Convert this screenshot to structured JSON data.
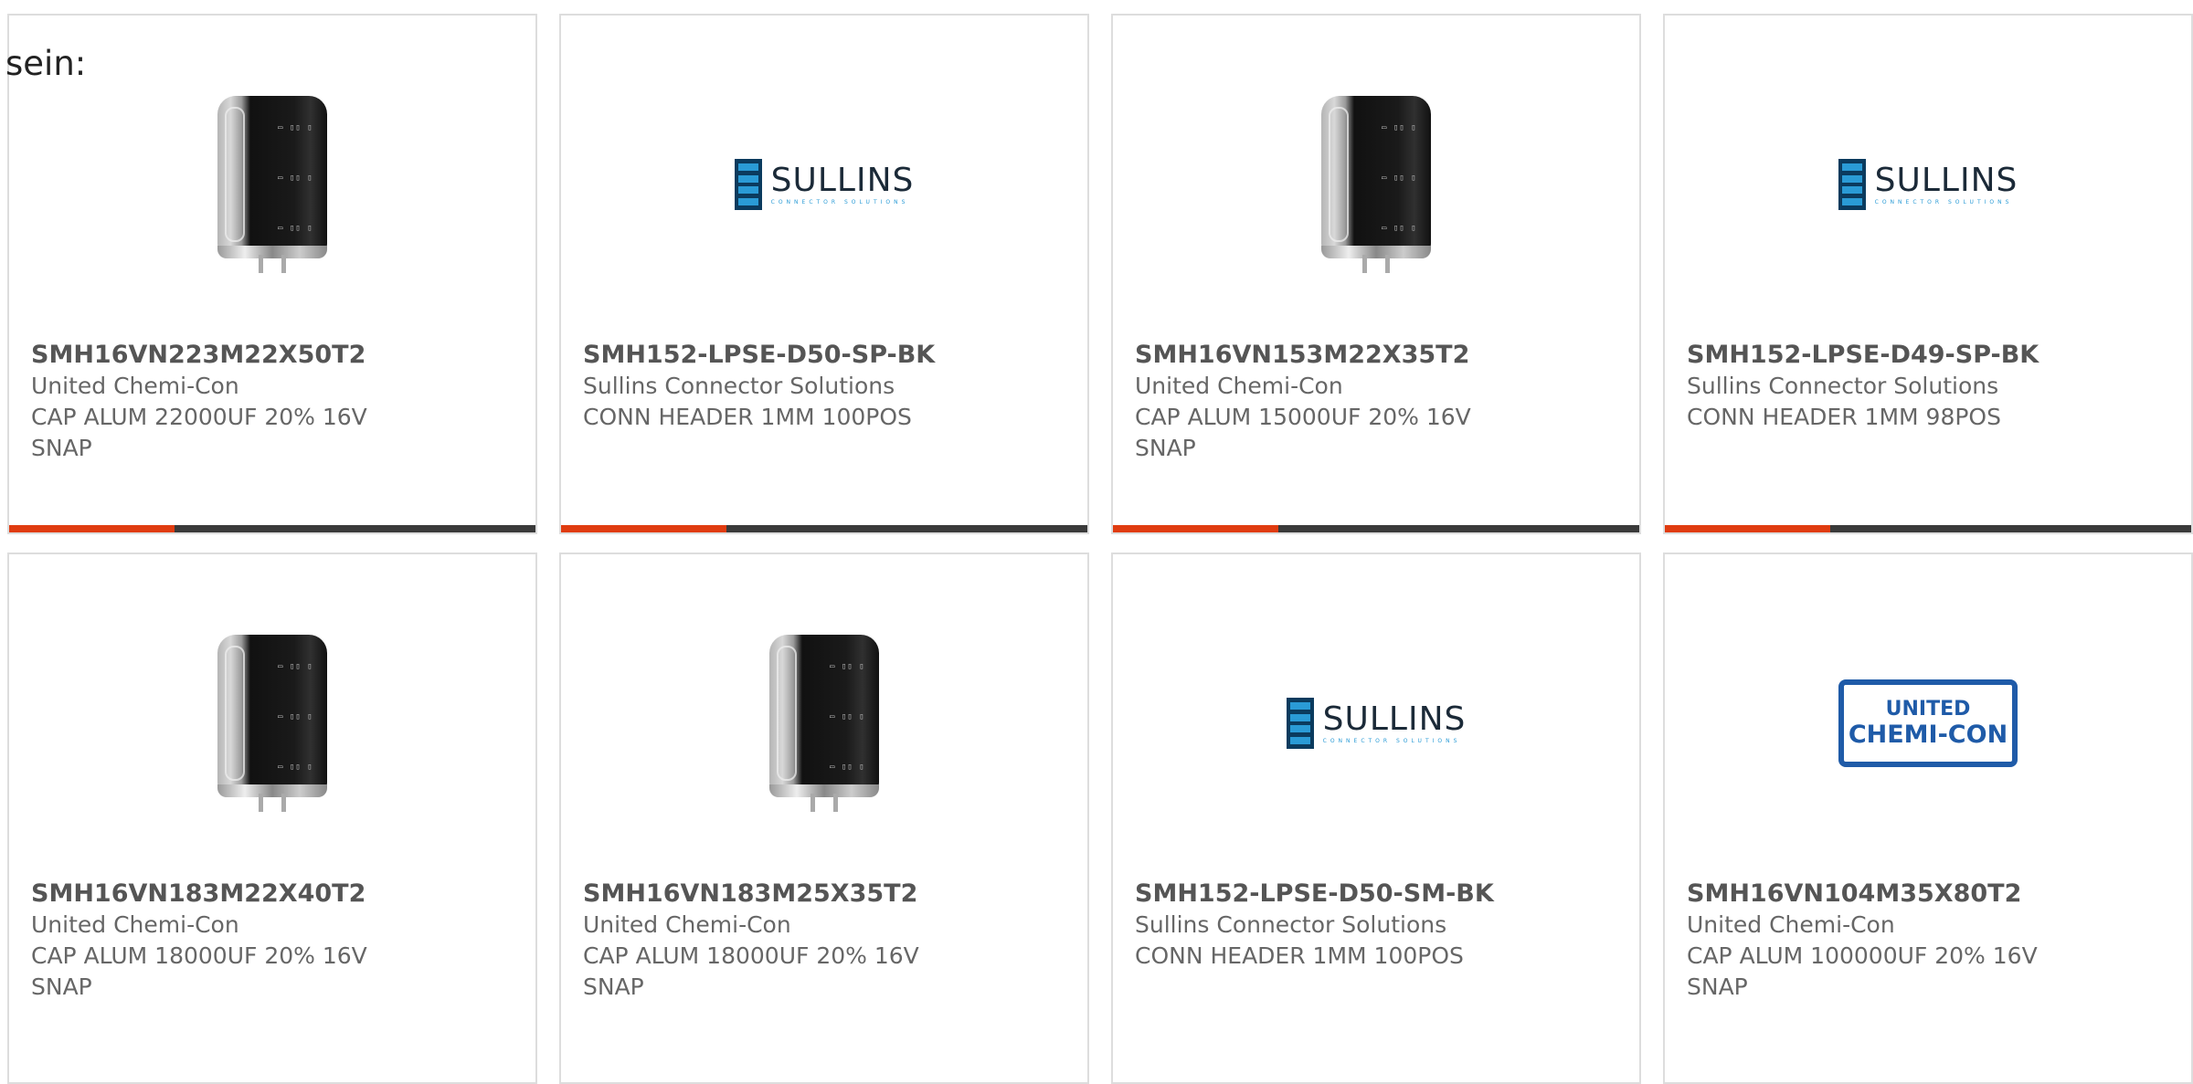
{
  "page_label": "sein:",
  "cards": [
    {
      "part_number": "SMH16VN223M22X50T2",
      "manufacturer": "United Chemi-Con",
      "description_line1": "CAP ALUM 22000UF 20% 16V",
      "description_line2": "SNAP",
      "image": "capacitor-photo"
    },
    {
      "part_number": "SMH152-LPSE-D50-SP-BK",
      "manufacturer": "Sullins Connector Solutions",
      "description_line1": "CONN HEADER 1MM 100POS",
      "description_line2": "",
      "image": "sullins-logo"
    },
    {
      "part_number": "SMH16VN153M22X35T2",
      "manufacturer": "United Chemi-Con",
      "description_line1": "CAP ALUM 15000UF 20% 16V",
      "description_line2": "SNAP",
      "image": "capacitor-photo"
    },
    {
      "part_number": "SMH152-LPSE-D49-SP-BK",
      "manufacturer": "Sullins Connector Solutions",
      "description_line1": "CONN HEADER 1MM 98POS",
      "description_line2": "",
      "image": "sullins-logo"
    },
    {
      "part_number": "SMH16VN183M22X40T2",
      "manufacturer": "United Chemi-Con",
      "description_line1": "CAP ALUM 18000UF 20% 16V",
      "description_line2": "SNAP",
      "image": "capacitor-photo"
    },
    {
      "part_number": "SMH16VN183M25X35T2",
      "manufacturer": "United Chemi-Con",
      "description_line1": "CAP ALUM 18000UF 20% 16V",
      "description_line2": "SNAP",
      "image": "capacitor-photo"
    },
    {
      "part_number": "SMH152-LPSE-D50-SM-BK",
      "manufacturer": "Sullins Connector Solutions",
      "description_line1": "CONN HEADER 1MM 100POS",
      "description_line2": "",
      "image": "sullins-logo"
    },
    {
      "part_number": "SMH16VN104M35X80T2",
      "manufacturer": "United Chemi-Con",
      "description_line1": "CAP ALUM 100000UF 20% 16V",
      "description_line2": "SNAP",
      "image": "ucc-logo"
    }
  ],
  "logos": {
    "sullins": {
      "name": "SULLINS",
      "tagline": "CONNECTOR SOLUTIONS"
    },
    "ucc": {
      "line1": "UNITED",
      "line2": "CHEMI-CON"
    }
  },
  "colors": {
    "accent": "#e03c10",
    "bar_dark": "#3a3a3a",
    "card_border": "#dddddd",
    "text": "#666666"
  },
  "progress_fraction": 0.315
}
